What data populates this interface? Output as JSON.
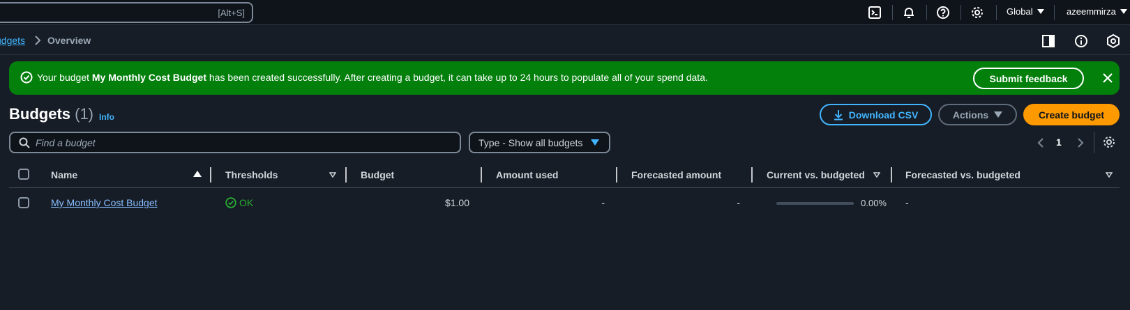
{
  "topnav": {
    "search_shortcut": "[Alt+S]",
    "region": "Global",
    "account": "azeemmirza"
  },
  "breadcrumb": {
    "parent": "udgets",
    "current": "Overview"
  },
  "flash": {
    "prefix": "Your budget ",
    "budget_name": "My Monthly Cost Budget",
    "suffix": " has been created successfully. After creating a budget, it can take up to 24 hours to populate all of your spend data.",
    "feedback_label": "Submit feedback"
  },
  "header": {
    "title": "Budgets",
    "count": "(1)",
    "info": "Info",
    "download_label": "Download CSV",
    "actions_label": "Actions",
    "create_label": "Create budget"
  },
  "filters": {
    "search_placeholder": "Find a budget",
    "type_label": "Type - Show all budgets"
  },
  "pagination": {
    "page": "1"
  },
  "table": {
    "columns": [
      "Name",
      "Thresholds",
      "Budget",
      "Amount used",
      "Forecasted amount",
      "Current vs. budgeted",
      "Forecasted vs. budgeted"
    ],
    "rows": [
      {
        "name": "My Monthly Cost Budget",
        "thresholds": "OK",
        "budget": "$1.00",
        "amount_used": "-",
        "forecasted_amount": "-",
        "current_vs_budgeted": "0.00%",
        "current_vs_budgeted_fraction": 0,
        "forecasted_vs_budgeted": "-"
      }
    ]
  },
  "colors": {
    "background": "#161d26",
    "success": "#037f0c",
    "accent": "#42b4ff",
    "primary_button": "#ff9900",
    "ok_status": "#29ad32"
  }
}
